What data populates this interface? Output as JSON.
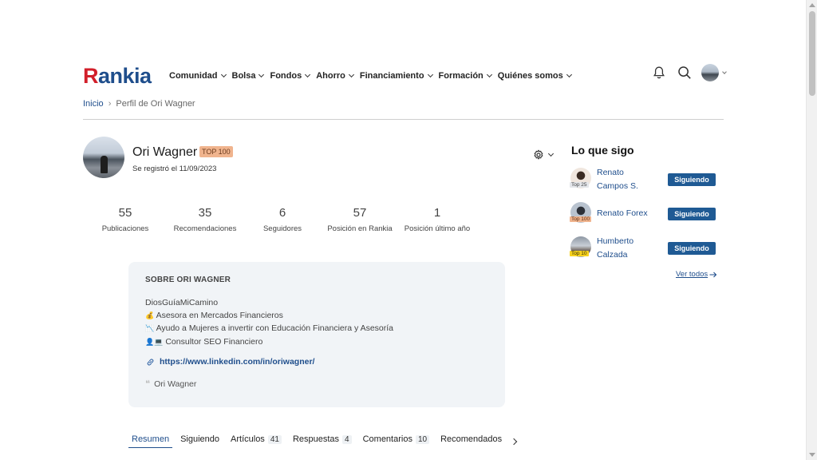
{
  "brand": {
    "logo_text_main": "Rank",
    "logo_text_accent": "ia"
  },
  "nav": {
    "items": [
      {
        "label": "Comunidad"
      },
      {
        "label": "Bolsa"
      },
      {
        "label": "Fondos"
      },
      {
        "label": "Ahorro"
      },
      {
        "label": "Financiamiento"
      },
      {
        "label": "Formación"
      },
      {
        "label": "Quiénes somos"
      }
    ]
  },
  "header_icons": [
    "bell-icon",
    "search-icon",
    "user-avatar",
    "chevron-down-icon"
  ],
  "breadcrumb": {
    "home": "Inicio",
    "separator": "›",
    "current": "Perfil de Ori Wagner"
  },
  "profile": {
    "name": "Ori Wagner",
    "badge": "TOP 100",
    "registered": "Se registró el 11/09/2023",
    "stats": [
      {
        "value": "55",
        "label": "Publicaciones"
      },
      {
        "value": "35",
        "label": "Recomendaciones"
      },
      {
        "value": "6",
        "label": "Seguidores"
      },
      {
        "value": "57",
        "label": "Posición en Rankia"
      },
      {
        "value": "1",
        "label": "Posición último año"
      }
    ]
  },
  "about": {
    "title": "SOBRE ORI WAGNER",
    "lines": [
      {
        "emoji": "",
        "text": "DiosGuíaMiCamino"
      },
      {
        "emoji": "💰",
        "text": "Asesora en Mercados Financieros"
      },
      {
        "emoji": "📉",
        "text": "Ayudo a Mujeres a invertir con Educación Financiera y Asesoría"
      },
      {
        "emoji": "👤💻",
        "text": "Consultor SEO Financiero"
      }
    ],
    "link": "https://www.linkedin.com/in/oriwagner/",
    "mention": "Ori Wagner"
  },
  "tabs": [
    {
      "label": "Resumen",
      "count": ""
    },
    {
      "label": "Siguiendo",
      "count": ""
    },
    {
      "label": "Artículos",
      "count": "41"
    },
    {
      "label": "Respuestas",
      "count": "4"
    },
    {
      "label": "Comentarios",
      "count": "10"
    },
    {
      "label": "Recomendados",
      "count": ""
    }
  ],
  "following": {
    "title": "Lo que sigo",
    "button_label": "Siguiendo",
    "see_all": "Ver todos",
    "items": [
      {
        "name_line1": "Renato",
        "name_line2": "Campos S.",
        "badge": "Top 25"
      },
      {
        "name_line1": "Renato Forex",
        "name_line2": "",
        "badge": "Top 100"
      },
      {
        "name_line1": "Humberto",
        "name_line2": "Calzada",
        "badge": "Top 10"
      }
    ]
  },
  "colors": {
    "brand_blue": "#1f4e8c",
    "brand_red": "#d21f2a",
    "badge_top100": "#f0b48e",
    "badge_top10": "#f7d21e",
    "badge_top25": "#e4e6ea",
    "button_blue": "#1f5a94"
  }
}
